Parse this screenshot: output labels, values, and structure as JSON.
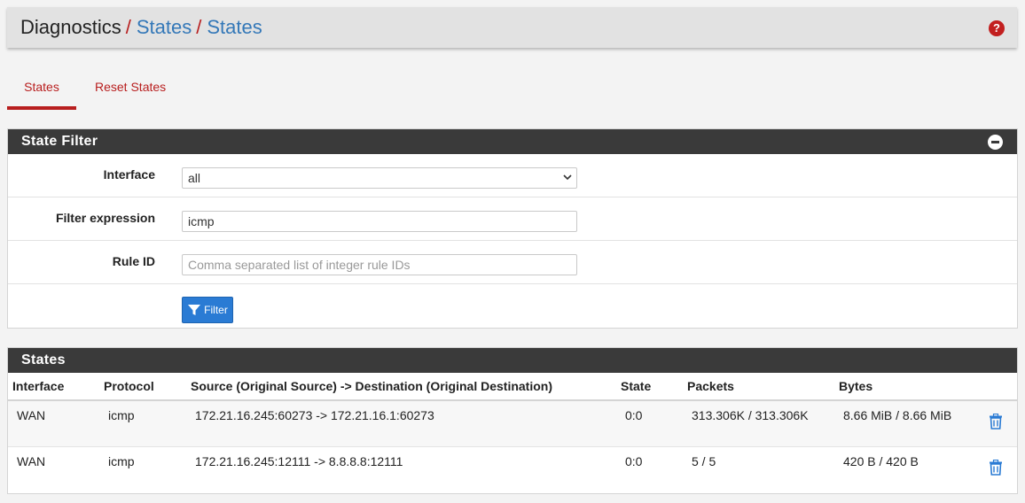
{
  "breadcrumb": {
    "root": "Diagnostics",
    "level1": "States",
    "level2": "States",
    "separator": "/"
  },
  "tabs": [
    {
      "label": "States",
      "active": true
    },
    {
      "label": "Reset States",
      "active": false
    }
  ],
  "filter_panel": {
    "title": "State Filter",
    "interface_label": "Interface",
    "interface_value": "all",
    "expression_label": "Filter expression",
    "expression_value": "icmp",
    "ruleid_label": "Rule ID",
    "ruleid_placeholder": "Comma separated list of integer rule IDs",
    "filter_button": "Filter"
  },
  "states_panel": {
    "title": "States",
    "columns": [
      "Interface",
      "Protocol",
      "Source (Original Source) -> Destination (Original Destination)",
      "State",
      "Packets",
      "Bytes"
    ],
    "rows": [
      {
        "interface": "WAN",
        "protocol": "icmp",
        "connection": "172.21.16.245:60273 -> 172.21.16.1:60273",
        "state": "0:0",
        "packets": "313.306K / 313.306K",
        "bytes": "8.66 MiB / 8.66 MiB"
      },
      {
        "interface": "WAN",
        "protocol": "icmp",
        "connection": "172.21.16.245:12111 -> 8.8.8.8:12111",
        "state": "0:0",
        "packets": "5 / 5",
        "bytes": "420 B / 420 B"
      }
    ]
  },
  "colors": {
    "accent": "#b81e1e",
    "link": "#3478b8",
    "button": "#2a7bd4",
    "panel_header": "#3a3a3a"
  },
  "icons": [
    "help-icon",
    "minus-circle-icon",
    "chevron-down-icon",
    "funnel-icon",
    "trash-icon"
  ]
}
